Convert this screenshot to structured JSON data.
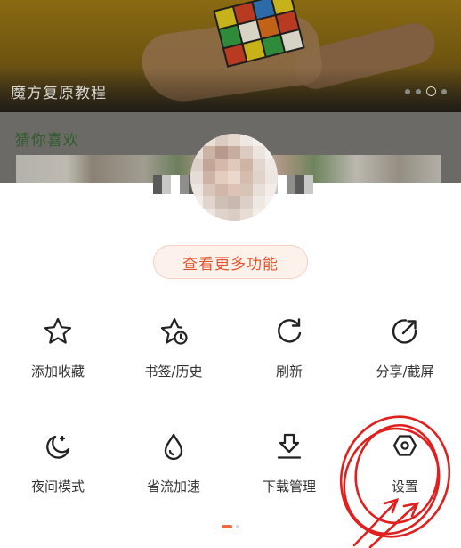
{
  "background": {
    "banner_title": "魔方复原教程",
    "section_title": "猜你喜欢"
  },
  "sheet": {
    "more_button": "查看更多功能",
    "items": [
      {
        "label": "添加收藏",
        "icon": "star-icon"
      },
      {
        "label": "书签/历史",
        "icon": "star-clock-icon"
      },
      {
        "label": "刷新",
        "icon": "refresh-icon"
      },
      {
        "label": "分享/截屏",
        "icon": "share-icon"
      },
      {
        "label": "夜间模式",
        "icon": "moon-icon"
      },
      {
        "label": "省流加速",
        "icon": "water-drop-icon"
      },
      {
        "label": "下载管理",
        "icon": "download-icon"
      },
      {
        "label": "设置",
        "icon": "settings-icon"
      }
    ],
    "page_indicator": {
      "pages": 2,
      "current": 1
    }
  },
  "colors": {
    "accent": "#e3562b",
    "annotation": "#e0201e",
    "text": "#333333"
  }
}
